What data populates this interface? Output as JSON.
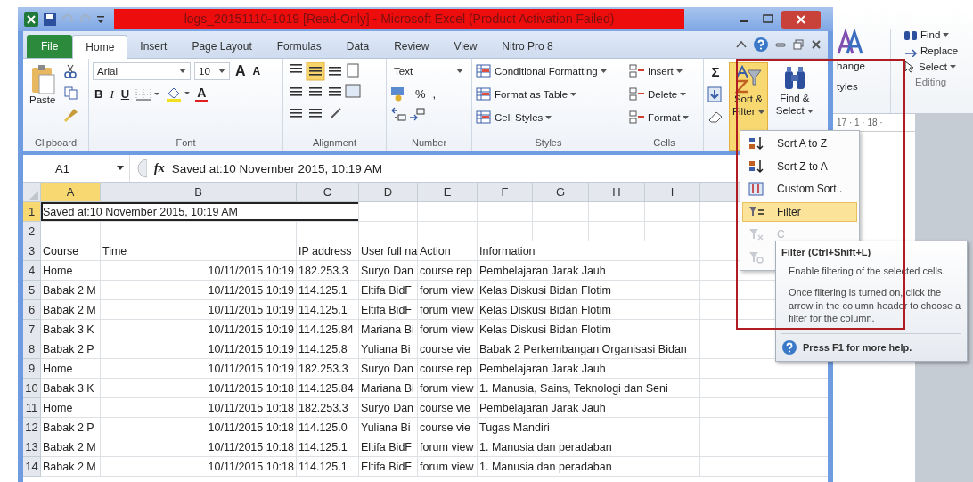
{
  "window": {
    "title": "logs_20151110-1019  [Read-Only]  -  Microsoft Excel (Product Activation Failed)"
  },
  "tabs": [
    {
      "label": "File",
      "kind": "file",
      "selected": false
    },
    {
      "label": "Home",
      "kind": "tab",
      "selected": true
    },
    {
      "label": "Insert",
      "kind": "tab",
      "selected": false
    },
    {
      "label": "Page Layout",
      "kind": "tab",
      "selected": false
    },
    {
      "label": "Formulas",
      "kind": "tab",
      "selected": false
    },
    {
      "label": "Data",
      "kind": "tab",
      "selected": false
    },
    {
      "label": "Review",
      "kind": "tab",
      "selected": false
    },
    {
      "label": "View",
      "kind": "tab",
      "selected": false
    },
    {
      "label": "Nitro Pro 8",
      "kind": "tab",
      "selected": false
    }
  ],
  "ribbon": {
    "clipboard": {
      "paste": "Paste",
      "label": "Clipboard"
    },
    "font": {
      "name": "Arial",
      "size": "10",
      "grow": "A",
      "shrink": "A",
      "bold": "B",
      "italic": "I",
      "underline": "U",
      "font_color_button": "A",
      "label": "Font"
    },
    "alignment": {
      "label": "Alignment"
    },
    "number": {
      "format": "Text",
      "percent": "%",
      "comma": ",",
      "label": "Number"
    },
    "styles": {
      "items": [
        "Conditional Formatting",
        "Format as Table",
        "Cell Styles"
      ],
      "label": "Styles"
    },
    "cells": {
      "items": [
        "Insert",
        "Delete",
        "Format"
      ],
      "label": "Cells"
    },
    "editing": {
      "sum": "Σ",
      "sort_filter": {
        "lines": [
          "Sort &",
          "Filter"
        ],
        "selected": true
      },
      "find_select": [
        "Find &",
        "Select"
      ]
    }
  },
  "formula_bar": {
    "cell": "A1",
    "function_label": "fx",
    "value": "Saved at:10 November 2015, 10:19 AM"
  },
  "sheet": {
    "columns": [
      {
        "label": "A",
        "selected": true
      },
      {
        "label": "B",
        "selected": false
      },
      {
        "label": "C",
        "selected": false
      },
      {
        "label": "D",
        "selected": false
      },
      {
        "label": "E",
        "selected": false
      },
      {
        "label": "F",
        "selected": false
      },
      {
        "label": "G",
        "selected": false
      },
      {
        "label": "H",
        "selected": false
      },
      {
        "label": "I",
        "selected": false
      }
    ],
    "rows": [
      {
        "number": "1",
        "selected": true,
        "kind": "note",
        "cells": [
          "Saved at:10 November 2015, 10:19 AM"
        ]
      },
      {
        "number": "2",
        "selected": false,
        "kind": "empty",
        "cells": []
      },
      {
        "number": "3",
        "selected": false,
        "kind": "header",
        "cells": [
          "Course",
          "Time",
          "IP address",
          "User full na",
          "Action",
          "Information"
        ]
      },
      {
        "number": "4",
        "selected": false,
        "kind": "data",
        "cells": [
          "Home",
          "10/11/2015 10:19",
          "182.253.3",
          "Suryo Dan",
          "course rep",
          "Pembelajaran Jarak Jauh"
        ]
      },
      {
        "number": "5",
        "selected": false,
        "kind": "data",
        "cells": [
          "Babak 2 M",
          "10/11/2015 10:19",
          "114.125.1",
          "Eltifa BidF",
          "forum view",
          "Kelas Diskusi Bidan Flotim"
        ]
      },
      {
        "number": "6",
        "selected": false,
        "kind": "data",
        "cells": [
          "Babak 2 M",
          "10/11/2015 10:19",
          "114.125.1",
          "Eltifa BidF",
          "forum view",
          "Kelas Diskusi Bidan Flotim"
        ]
      },
      {
        "number": "7",
        "selected": false,
        "kind": "data",
        "cells": [
          "Babak 3 K",
          "10/11/2015 10:19",
          "114.125.84",
          "Mariana Bi",
          "forum view",
          "Kelas Diskusi Bidan Flotim"
        ]
      },
      {
        "number": "8",
        "selected": false,
        "kind": "data",
        "cells": [
          "Babak 2 P",
          "10/11/2015 10:19",
          "114.125.8",
          "Yuliana Bi",
          "course vie",
          "Babak 2 Perkembangan Organisasi Bidan"
        ]
      },
      {
        "number": "9",
        "selected": false,
        "kind": "data",
        "cells": [
          "Home",
          "10/11/2015 10:19",
          "182.253.3",
          "Suryo Dan",
          "course rep",
          "Pembelajaran Jarak Jauh"
        ]
      },
      {
        "number": "10",
        "selected": false,
        "kind": "data",
        "cells": [
          "Babak 3 K",
          "10/11/2015 10:18",
          "114.125.84",
          "Mariana Bi",
          "forum view",
          "1. Manusia, Sains, Teknologi dan Seni"
        ]
      },
      {
        "number": "11",
        "selected": false,
        "kind": "data",
        "cells": [
          "Home",
          "10/11/2015 10:18",
          "182.253.3",
          "Suryo Dan",
          "course vie",
          "Pembelajaran Jarak Jauh"
        ]
      },
      {
        "number": "12",
        "selected": false,
        "kind": "data",
        "cells": [
          "Babak 2 P",
          "10/11/2015 10:18",
          "114.125.0",
          "Yuliana Bi",
          "course vie",
          "Tugas Mandiri"
        ]
      },
      {
        "number": "13",
        "selected": false,
        "kind": "data",
        "cells": [
          "Babak 2 M",
          "10/11/2015 10:18",
          "114.125.1",
          "Eltifa BidF",
          "forum view",
          "1. Manusia dan peradaban"
        ]
      },
      {
        "number": "14",
        "selected": false,
        "kind": "data",
        "cells": [
          "Babak 2 M",
          "10/11/2015 10:18",
          "114.125.1",
          "Eltifa BidF",
          "forum view",
          "1. Manusia dan peradaban"
        ]
      }
    ]
  },
  "sort_menu": {
    "items": [
      {
        "label": "Sort A to Z",
        "kind": "sort-asc",
        "selected": false,
        "disabled": false
      },
      {
        "label": "Sort Z to A",
        "kind": "sort-desc",
        "selected": false,
        "disabled": false
      },
      {
        "label": "Custom Sort..",
        "kind": "custom",
        "selected": false,
        "disabled": false
      },
      {
        "label": "Filter",
        "kind": "filter",
        "selected": true,
        "disabled": false
      },
      {
        "label": "C",
        "kind": "clear",
        "selected": false,
        "disabled": true
      },
      {
        "kind": "reapply",
        "selected": false,
        "disabled": true
      }
    ]
  },
  "tooltip": {
    "title": "Filter (Ctrl+Shift+L)",
    "paragraphs": [
      "Enable filtering of the selected cells.",
      "Once filtering is turned on, click the arrow in the column header to choose a filter for the column."
    ],
    "help": "Press F1 for more help."
  },
  "background_window": {
    "styles_label": [
      "hange",
      "tyles"
    ],
    "find": "Find",
    "replace": "Replace",
    "select": "Select",
    "group": "Editing",
    "ruler": "17 · 1 · 18 ·"
  }
}
